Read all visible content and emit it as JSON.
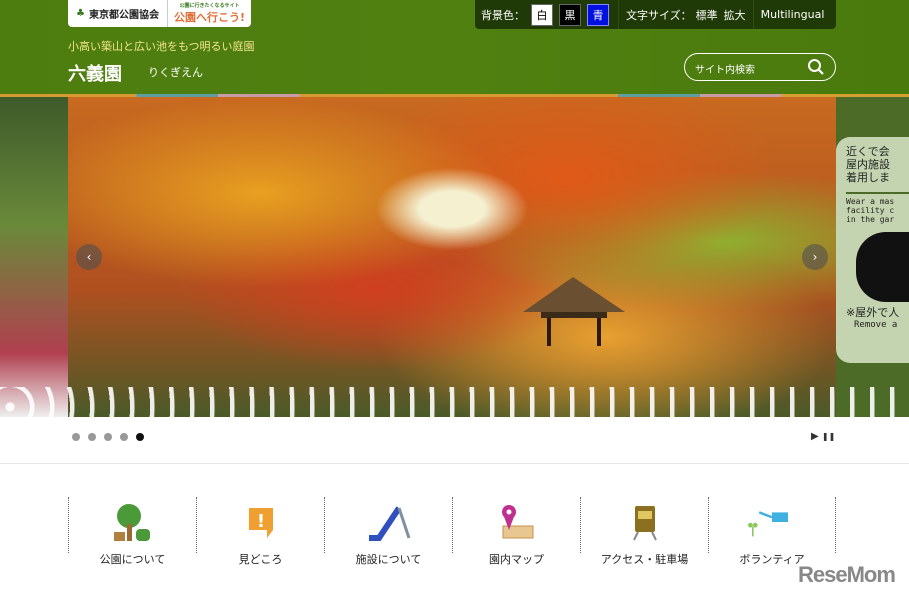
{
  "header": {
    "org_logo": "東京都公園協会",
    "site_logo": "公園へ行こう!",
    "site_logo_sub": "公園に行きたくなるサイト",
    "tagline": "小高い築山と広い池をもつ明るい庭園",
    "title": "六義園",
    "reading": "りくぎえん"
  },
  "util": {
    "bg_label": "背景色：",
    "bg_white": "白",
    "bg_black": "黒",
    "bg_blue": "青",
    "font_label": "文字サイズ：",
    "font_standard": "標準",
    "font_large": "拡大",
    "multilingual": "Multilingual"
  },
  "search": {
    "placeholder": "サイト内検索"
  },
  "notice": {
    "jp1": "近くで会",
    "jp2": "屋内施設",
    "jp3": "着用しま",
    "en1": "Wear a mas",
    "en2": "facility c",
    "en3": "in the gar",
    "foot_jp": "※屋外で人",
    "foot_en": "Remove a"
  },
  "slider": {
    "prev": "‹",
    "next": "›",
    "slides": 5,
    "active": 5,
    "play": "▶",
    "pause": "❚❚"
  },
  "nav": [
    {
      "label": "公園について",
      "icon": "tree-icon"
    },
    {
      "label": "見どころ",
      "icon": "exclamation-bubble-icon"
    },
    {
      "label": "施設について",
      "icon": "slide-icon"
    },
    {
      "label": "園内マップ",
      "icon": "map-pin-icon"
    },
    {
      "label": "アクセス・駐車場",
      "icon": "train-icon"
    },
    {
      "label": "ボランティア",
      "icon": "watering-can-icon"
    }
  ],
  "watermark": "ReseMom"
}
